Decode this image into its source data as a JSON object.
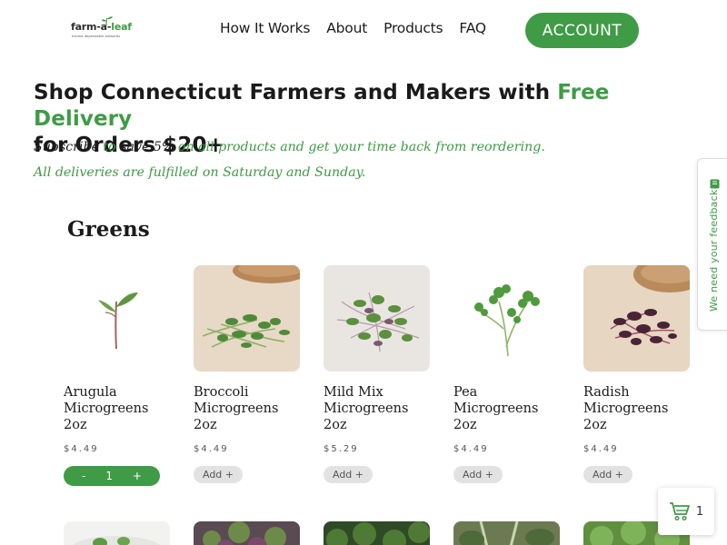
{
  "brand": {
    "logo_text_main": "farm-a-",
    "logo_text_accent": "leaf",
    "tagline": "honest dependable stewards"
  },
  "nav": {
    "items": [
      "How It Works",
      "About",
      "Products",
      "FAQ"
    ],
    "account_label": "ACCOUNT"
  },
  "hero": {
    "title_part1": "Shop Connecticut Farmers and Makers with ",
    "title_green": "Free Delivery",
    "title_part2": "for Orders $20+",
    "subscribe_word": "Subscribe",
    "to_word": " to ",
    "save_word": "save 5%",
    "subscribe_rest": " on all products and get your time back from reordering.",
    "delivery_note": "All deliveries are fulfilled on Saturday and Sunday."
  },
  "section": {
    "title": "Greens"
  },
  "products": [
    {
      "name": "Arugula Microgreens 2oz",
      "price": "$4.49",
      "in_cart": true,
      "qty": "1",
      "minus": "-",
      "plus": "+"
    },
    {
      "name": "Broccoli Microgreens 2oz",
      "price": "$4.49",
      "in_cart": false,
      "add_label": "Add +"
    },
    {
      "name": "Mild Mix Microgreens 2oz",
      "price": "$5.29",
      "in_cart": false,
      "add_label": "Add +"
    },
    {
      "name": "Pea Microgreens 2oz",
      "price": "$4.49",
      "in_cart": false,
      "add_label": "Add +"
    },
    {
      "name": "Radish Microgreens 2oz",
      "price": "$4.49",
      "in_cart": false,
      "add_label": "Add +"
    }
  ],
  "feedback": {
    "label": "We need your feedback"
  },
  "cart": {
    "count": "1"
  },
  "colors": {
    "accent": "#3f9b45",
    "text": "#1b1b1b",
    "add_bg": "#e2e2e2"
  }
}
